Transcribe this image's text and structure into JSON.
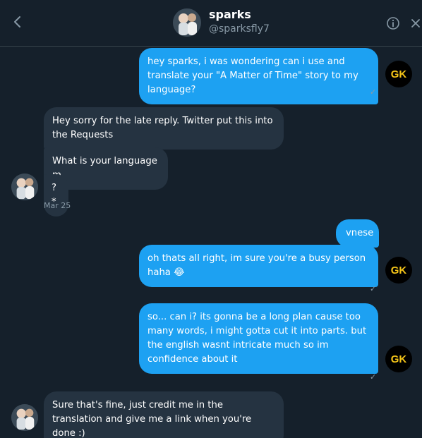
{
  "header": {
    "name": "sparks",
    "handle": "@sparksfly7",
    "icons": {
      "back": "chevron-left-icon",
      "info": "info-icon",
      "close": "close-icon"
    }
  },
  "colors": {
    "background": "#15202b",
    "sent_bubble": "#1da1f2",
    "received_bubble": "#253341",
    "muted": "#8899a6",
    "gk_text": "#f5c518"
  },
  "user_avatar_label": "GK",
  "messages": [
    {
      "direction": "sent",
      "text": "hey sparks, i was wondering can i use and translate your \"A Matter of Time\" story to my language?"
    },
    {
      "direction": "received",
      "text": "Hey sorry for the late reply. Twitter put this into the Requests"
    },
    {
      "direction": "received",
      "text": "What is your language m"
    },
    {
      "direction": "received",
      "text": "?*"
    },
    {
      "direction": "sent",
      "text": "vnese"
    },
    {
      "direction": "sent",
      "text": "oh thats all right, im sure you're a busy person haha 😂"
    },
    {
      "direction": "sent",
      "text": "so... can i? its gonna be a long plan cause too many words, i might gotta cut it into parts. but the english wasnt intricate much so im confidence about it"
    },
    {
      "direction": "received",
      "text": "Sure that's fine, just credit me in the translation and give me a link when you're done :)"
    }
  ],
  "timestamps": {
    "received_group_1": "Mar 25"
  },
  "read_mark": "✓"
}
